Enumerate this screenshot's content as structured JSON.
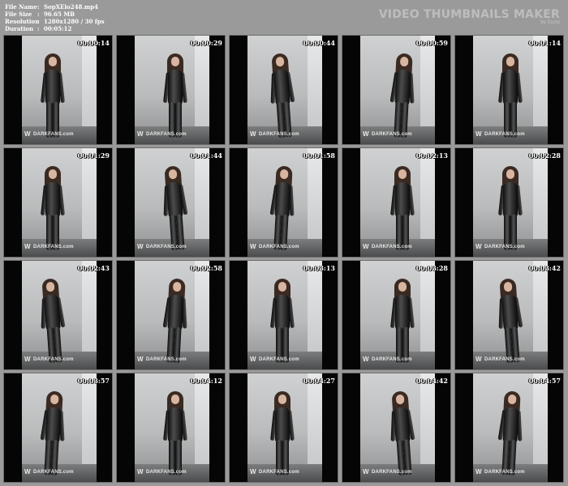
{
  "info": {
    "file_name_label": "File Name",
    "file_name_value": "SopXElo248.mp4",
    "file_size_label": "File Size",
    "file_size_value": "96.65 MB",
    "resolution_label": "Resolution",
    "resolution_value": "1280x1280 / 30 fps",
    "duration_label": "Duration",
    "duration_value": "00:05:12",
    "separator": ":"
  },
  "brand": {
    "title": "VIDEO THUMBNAILS MAKER",
    "by": "by Scorp"
  },
  "watermark": {
    "logo": "W",
    "text": "DARKFANS.com"
  },
  "colors": {
    "sheet_background": "#9a9a9a",
    "thumb_letterbox": "#050505",
    "timestamp_text": "#ffffff"
  },
  "thumbnails": [
    {
      "time": "00:00:14"
    },
    {
      "time": "00:00:29"
    },
    {
      "time": "00:00:44"
    },
    {
      "time": "00:00:59"
    },
    {
      "time": "00:01:14"
    },
    {
      "time": "00:01:29"
    },
    {
      "time": "00:01:44"
    },
    {
      "time": "00:01:58"
    },
    {
      "time": "00:02:13"
    },
    {
      "time": "00:02:28"
    },
    {
      "time": "00:02:43"
    },
    {
      "time": "00:02:58"
    },
    {
      "time": "00:03:13"
    },
    {
      "time": "00:03:28"
    },
    {
      "time": "00:03:42"
    },
    {
      "time": "00:03:57"
    },
    {
      "time": "00:04:12"
    },
    {
      "time": "00:04:27"
    },
    {
      "time": "00:04:42"
    },
    {
      "time": "00:04:57"
    }
  ]
}
